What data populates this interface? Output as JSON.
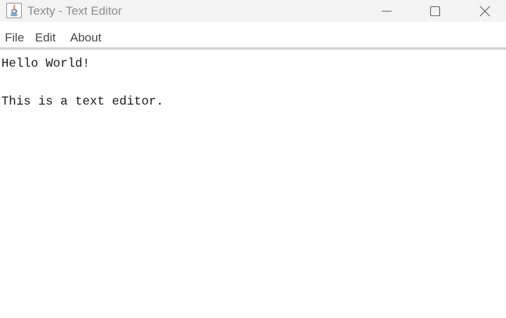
{
  "window": {
    "title": "Texty - Text Editor",
    "app_icon": "java-icon",
    "controls": {
      "minimize_icon": "minimize-icon",
      "maximize_icon": "maximize-icon",
      "close_icon": "close-icon"
    }
  },
  "menubar": {
    "items": [
      {
        "label": "File"
      },
      {
        "label": "Edit"
      },
      {
        "label": "About"
      }
    ]
  },
  "editor": {
    "lines": [
      "Hello World!",
      "",
      "This is a text editor."
    ]
  },
  "colors": {
    "titlebar_bg": "#f3f3f3",
    "title_text": "#8c8c8c",
    "menu_text": "#444444",
    "editor_text": "#1a1a1a"
  }
}
